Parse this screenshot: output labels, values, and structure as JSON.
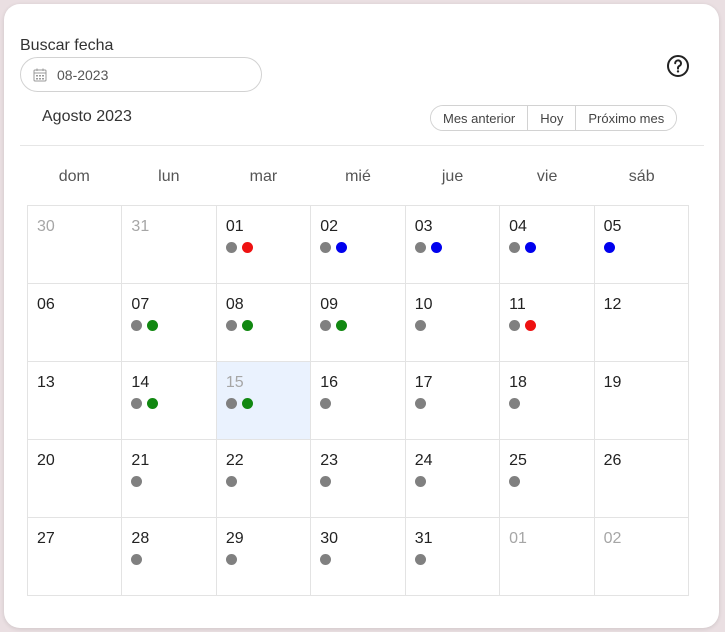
{
  "search": {
    "label": "Buscar fecha",
    "value": "08-2023",
    "icon": "calendar-icon"
  },
  "help": {
    "icon": "help-circle-icon"
  },
  "calendar": {
    "month_title": "Agosto 2023",
    "nav": {
      "prev_label": "Mes anterior",
      "today_label": "Hoy",
      "next_label": "Próximo mes"
    },
    "weekdays": [
      "dom",
      "lun",
      "mar",
      "mié",
      "jue",
      "vie",
      "sáb"
    ],
    "dot_colors": {
      "gray": "#808080",
      "red": "#ee1111",
      "blue": "#0000ee",
      "green": "#118811"
    },
    "days": [
      {
        "label": "30",
        "other": true,
        "dots": []
      },
      {
        "label": "31",
        "other": true,
        "dots": []
      },
      {
        "label": "01",
        "dots": [
          "gray",
          "red"
        ]
      },
      {
        "label": "02",
        "dots": [
          "gray",
          "blue"
        ]
      },
      {
        "label": "03",
        "dots": [
          "gray",
          "blue"
        ]
      },
      {
        "label": "04",
        "dots": [
          "gray",
          "blue"
        ]
      },
      {
        "label": "05",
        "dots": [
          "blue"
        ]
      },
      {
        "label": "06",
        "dots": []
      },
      {
        "label": "07",
        "dots": [
          "gray",
          "green"
        ]
      },
      {
        "label": "08",
        "dots": [
          "gray",
          "green"
        ]
      },
      {
        "label": "09",
        "dots": [
          "gray",
          "green"
        ]
      },
      {
        "label": "10",
        "dots": [
          "gray"
        ]
      },
      {
        "label": "11",
        "dots": [
          "gray",
          "red"
        ]
      },
      {
        "label": "12",
        "dots": []
      },
      {
        "label": "13",
        "dots": []
      },
      {
        "label": "14",
        "dots": [
          "gray",
          "green"
        ]
      },
      {
        "label": "15",
        "today": true,
        "dots": [
          "gray",
          "green"
        ]
      },
      {
        "label": "16",
        "dots": [
          "gray"
        ]
      },
      {
        "label": "17",
        "dots": [
          "gray"
        ]
      },
      {
        "label": "18",
        "dots": [
          "gray"
        ]
      },
      {
        "label": "19",
        "dots": []
      },
      {
        "label": "20",
        "dots": []
      },
      {
        "label": "21",
        "dots": [
          "gray"
        ]
      },
      {
        "label": "22",
        "dots": [
          "gray"
        ]
      },
      {
        "label": "23",
        "dots": [
          "gray"
        ]
      },
      {
        "label": "24",
        "dots": [
          "gray"
        ]
      },
      {
        "label": "25",
        "dots": [
          "gray"
        ]
      },
      {
        "label": "26",
        "dots": []
      },
      {
        "label": "27",
        "dots": []
      },
      {
        "label": "28",
        "dots": [
          "gray"
        ]
      },
      {
        "label": "29",
        "dots": [
          "gray"
        ]
      },
      {
        "label": "30",
        "dots": [
          "gray"
        ]
      },
      {
        "label": "31",
        "dots": [
          "gray"
        ]
      },
      {
        "label": "01",
        "other": true,
        "dots": []
      },
      {
        "label": "02",
        "other": true,
        "dots": []
      }
    ]
  }
}
